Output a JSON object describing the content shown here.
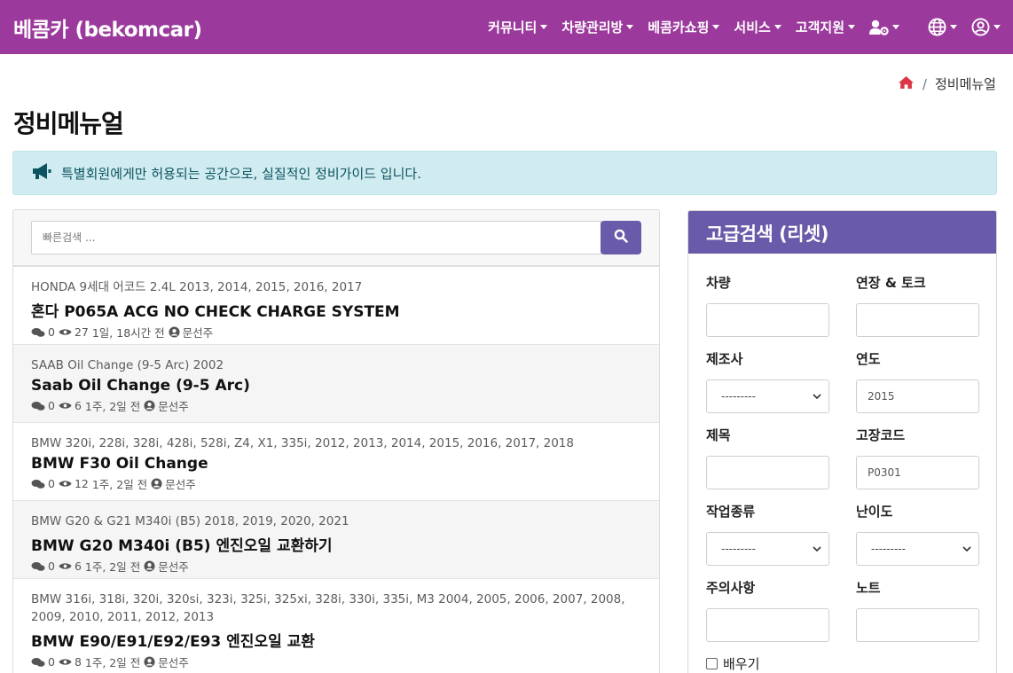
{
  "brand": "베콤카 (bekomcar)",
  "nav": {
    "items": [
      {
        "label": "커뮤니티"
      },
      {
        "label": "차량관리방"
      },
      {
        "label": "베콤카쇼핑"
      },
      {
        "label": "서비스"
      },
      {
        "label": "고객지원"
      }
    ]
  },
  "breadcrumb": {
    "current": "정비메뉴얼",
    "separator": "/"
  },
  "page_title": "정비메뉴얼",
  "alert": {
    "text": "특별회원에게만 허용되는 공간으로, 실질적인 정비가이드 입니다."
  },
  "search": {
    "placeholder": "빠른검색 ..."
  },
  "list": [
    {
      "sub": "HONDA 9세대 어코드 2.4L 2013, 2014, 2015, 2016, 2017",
      "title": "혼다 P065A ACG NO CHECK CHARGE SYSTEM",
      "comments": "0",
      "views": "27",
      "time": "1일, 18시간 전",
      "author": "문선주"
    },
    {
      "sub": "SAAB Oil Change (9-5 Arc) 2002",
      "title": "Saab Oil Change (9-5 Arc)",
      "comments": "0",
      "views": "6",
      "time": "1주, 2일 전",
      "author": "문선주"
    },
    {
      "sub": "BMW 320i, 228i, 328i, 428i, 528i, Z4, X1, 335i, 2012, 2013, 2014, 2015, 2016, 2017, 2018",
      "title": "BMW F30 Oil Change",
      "comments": "0",
      "views": "12",
      "time": "1주, 2일 전",
      "author": "문선주"
    },
    {
      "sub": "BMW G20 & G21 M340i (B5) 2018, 2019, 2020, 2021",
      "title": "BMW G20 M340i (B5) 엔진오일 교환하기",
      "comments": "0",
      "views": "6",
      "time": "1주, 2일 전",
      "author": "문선주"
    },
    {
      "sub": "BMW 316i, 318i, 320i, 320si, 323i, 325i, 325xi, 328i, 330i, 335i, M3 2004, 2005, 2006, 2007, 2008, 2009, 2010, 2011, 2012, 2013",
      "title": "BMW E90/E91/E92/E93 엔진오일 교환",
      "comments": "0",
      "views": "8",
      "time": "1주, 2일 전",
      "author": "문선주"
    }
  ],
  "advanced": {
    "title": "고급검색 (리셋)",
    "vehicle": {
      "label": "차량",
      "value": ""
    },
    "tool_torque": {
      "label": "연장 & 토크",
      "value": ""
    },
    "maker": {
      "label": "제조사",
      "value": "---------"
    },
    "year": {
      "label": "연도",
      "value": "2015"
    },
    "subject": {
      "label": "제목",
      "value": ""
    },
    "fault_code": {
      "label": "고장코드",
      "value": "P0301"
    },
    "work_type": {
      "label": "작업종류",
      "value": "---------"
    },
    "difficulty": {
      "label": "난이도",
      "value": "---------"
    },
    "caution": {
      "label": "주의사항",
      "value": ""
    },
    "note": {
      "label": "노트",
      "value": ""
    },
    "learn": {
      "label": "배우기"
    }
  },
  "colors": {
    "navbar": "#9b3a9c",
    "accent": "#6a5aaa",
    "alert_bg": "#d1ecf1",
    "home_icon": "#dc3545"
  }
}
